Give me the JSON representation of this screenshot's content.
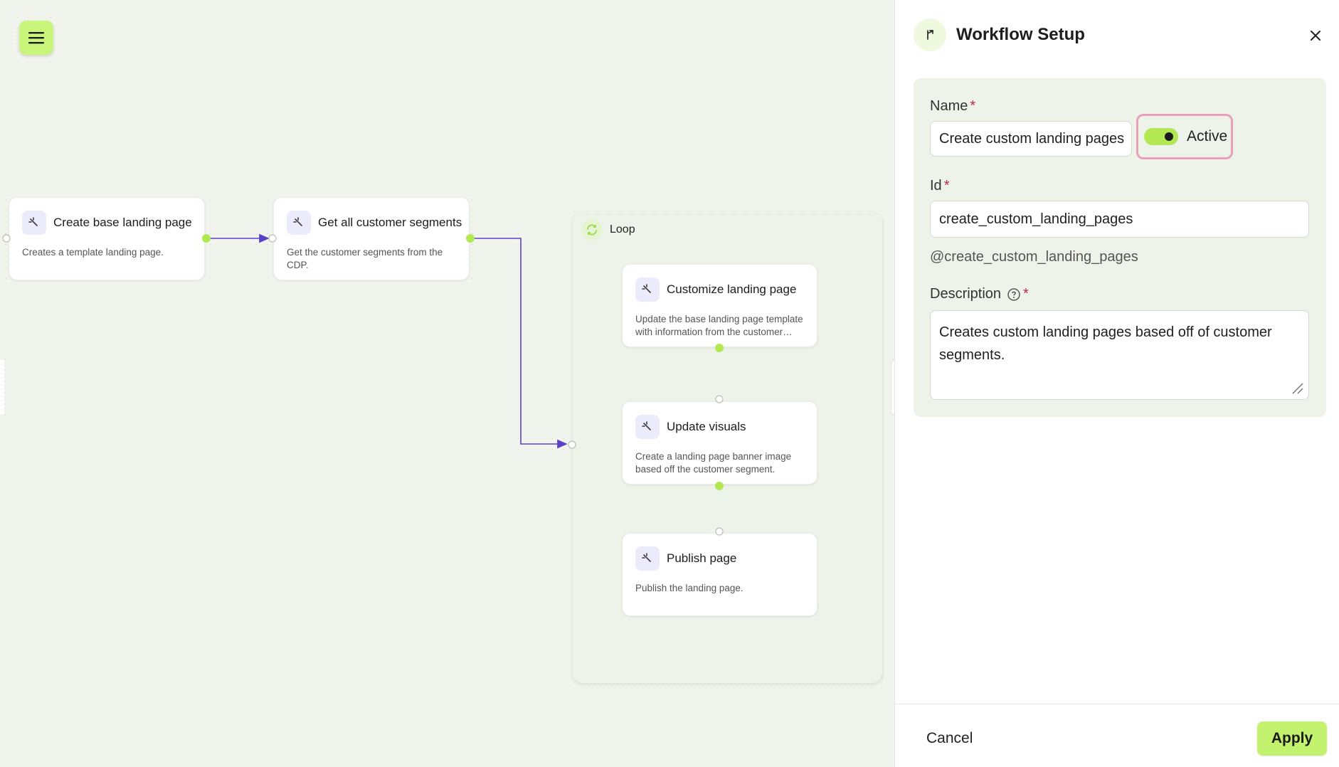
{
  "canvas": {
    "nodes": [
      {
        "title": "Create base landing page",
        "desc": "Creates a template landing page."
      },
      {
        "title": "Get all customer segments",
        "desc": "Get the customer segments from the CDP."
      },
      {
        "title": "Customize landing page",
        "desc": "Update the base landing page template with information from the customer…"
      },
      {
        "title": "Update visuals",
        "desc": "Create a landing page banner image based off the customer segment."
      },
      {
        "title": "Publish page",
        "desc": "Publish the landing page."
      }
    ],
    "loop": {
      "label": "Loop"
    }
  },
  "panel": {
    "title": "Workflow Setup",
    "name_label": "Name",
    "name_value": "Create custom landing pages",
    "toggle_label": "Active",
    "toggle_on": true,
    "id_label": "Id",
    "id_value": "create_custom_landing_pages",
    "handle": "@create_custom_landing_pages",
    "description_label": "Description",
    "description_value": "Creates custom landing pages based off of customer segments.",
    "required_mark": "*",
    "cancel_label": "Cancel",
    "apply_label": "Apply"
  },
  "colors": {
    "accent": "#c2f26e",
    "edge": "#5b3fc9",
    "port": "#b2e852",
    "required": "#c0284a",
    "highlight": "#e8a1b9"
  }
}
